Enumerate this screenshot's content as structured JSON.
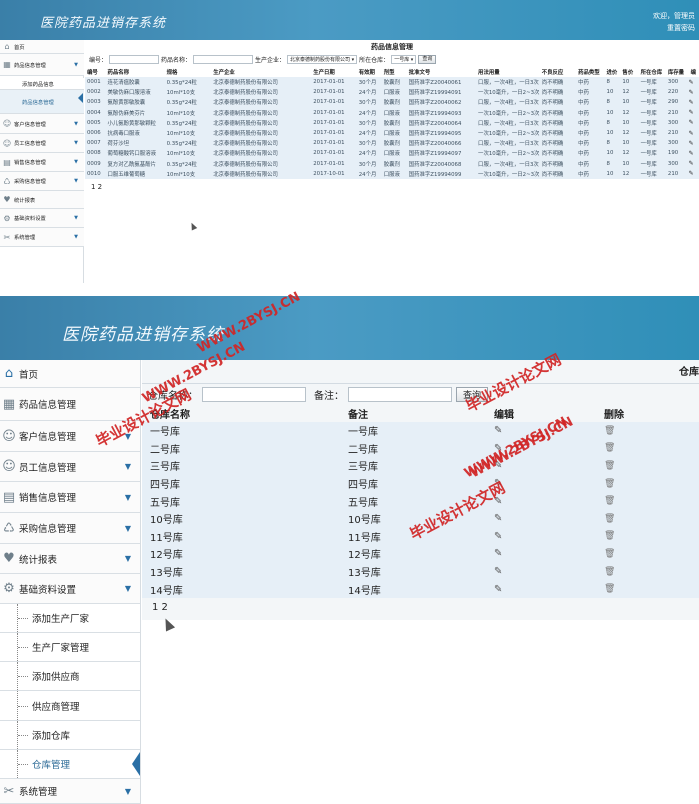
{
  "s1": {
    "logo": "医院药品进销存系统",
    "welcome": "欢迎，",
    "user": "管理员",
    "user2": "重置密码",
    "nav": [
      {
        "label": "首页",
        "icon": "home-icon",
        "arrow": ""
      },
      {
        "label": "药品信息管理",
        "icon": "grid-icon",
        "arrow": "▼"
      },
      {
        "label": "添加药品信息",
        "icon": "",
        "arrow": ""
      },
      {
        "label": "药品信息管理",
        "icon": "",
        "arrow": ""
      },
      {
        "label": "客户信息管理",
        "icon": "user-icon",
        "arrow": "▼"
      },
      {
        "label": "员工信息管理",
        "icon": "user-icon",
        "arrow": "▼"
      },
      {
        "label": "销售信息管理",
        "icon": "chart-icon",
        "arrow": "▼"
      },
      {
        "label": "采购信息管理",
        "icon": "cart-icon",
        "arrow": "▼"
      },
      {
        "label": "统计报表",
        "icon": "heart-icon",
        "arrow": ""
      },
      {
        "label": "基础资料设置",
        "icon": "settings-icon",
        "arrow": "▼"
      },
      {
        "label": "系统管理",
        "icon": "tools-icon",
        "arrow": "▼"
      }
    ],
    "title": "药品信息管理",
    "filters": {
      "code": "编号：",
      "name": "药品名称：",
      "maker": "生产企业：",
      "maker_value": "北京泰德制药股份有限公司",
      "store": "所在仓库：",
      "store_value": "一号库",
      "query": "查询"
    },
    "cols": [
      "编号",
      "药品名称",
      "规格",
      "生产企业",
      "生产日期",
      "有效期",
      "剂型",
      "批准文号",
      "用法用量",
      "不良反应",
      "药品类型",
      "进价",
      "售价",
      "所在仓库",
      "库存量",
      "编"
    ],
    "rows": [
      [
        "0001",
        "连花清瘟胶囊",
        "0.35g*24粒",
        "北京泰德制药股份有限公司",
        "2017-01-01",
        "30个月",
        "胶囊剂",
        "国药准字Z20040061",
        "口服，一次4粒，一日3次",
        "尚不明确",
        "中药",
        "8",
        "10",
        "一号库",
        "300"
      ],
      [
        "0002",
        "美敏伪麻口服溶液",
        "10ml*10支",
        "北京泰德制药股份有限公司",
        "2017-01-01",
        "24个月",
        "口服液",
        "国药准字Z19994091",
        "一次10毫升，一日2~3次",
        "尚不明确",
        "中药",
        "10",
        "12",
        "一号库",
        "220"
      ],
      [
        "0003",
        "氨酚黄那敏胶囊",
        "0.35g*24粒",
        "北京泰德制药股份有限公司",
        "2017-01-01",
        "30个月",
        "胶囊剂",
        "国药准字Z20040062",
        "口服，一次4粒，一日3次",
        "尚不明确",
        "中药",
        "8",
        "10",
        "一号库",
        "290"
      ],
      [
        "0004",
        "氨酚伪麻美芬片",
        "10ml*10支",
        "北京泰德制药股份有限公司",
        "2017-01-01",
        "24个月",
        "口服液",
        "国药准字Z19994093",
        "一次10毫升，一日2~3次",
        "尚不明确",
        "中药",
        "10",
        "12",
        "一号库",
        "210"
      ],
      [
        "0005",
        "小儿氨酚黄那敏颗粒",
        "0.35g*24粒",
        "北京泰德制药股份有限公司",
        "2017-01-01",
        "30个月",
        "胶囊剂",
        "国药准字Z20040064",
        "口服，一次4粒，一日3次",
        "尚不明确",
        "中药",
        "8",
        "10",
        "一号库",
        "300"
      ],
      [
        "0006",
        "抗病毒口服液",
        "10ml*10支",
        "北京泰德制药股份有限公司",
        "2017-01-01",
        "24个月",
        "口服液",
        "国药准字Z19994095",
        "一次10毫升，一日2~3次",
        "尚不明确",
        "中药",
        "10",
        "12",
        "一号库",
        "210"
      ],
      [
        "0007",
        "荷芬沙坦",
        "0.35g*24粒",
        "北京泰德制药股份有限公司",
        "2017-01-01",
        "30个月",
        "胶囊剂",
        "国药准字Z20040066",
        "口服，一次4粒，一日3次",
        "尚不明确",
        "中药",
        "8",
        "10",
        "一号库",
        "300"
      ],
      [
        "0008",
        "葡萄糖酸钙口服溶液",
        "10ml*10支",
        "北京泰德制药股份有限公司",
        "2017-01-01",
        "24个月",
        "口服液",
        "国药准字Z19994097",
        "一次10毫升，一日2~3次",
        "尚不明确",
        "中药",
        "10",
        "12",
        "一号库",
        "190"
      ],
      [
        "0009",
        "复方对乙酰氨基酚片",
        "0.35g*24粒",
        "北京泰德制药股份有限公司",
        "2017-01-01",
        "30个月",
        "胶囊剂",
        "国药准字Z20040068",
        "口服，一次4粒，一日3次",
        "尚不明确",
        "中药",
        "8",
        "10",
        "一号库",
        "300"
      ],
      [
        "0010",
        "口服五维葡萄糖",
        "10ml*10支",
        "北京泰德制药股份有限公司",
        "2017-10-01",
        "24个月",
        "口服液",
        "国药准字Z19994099",
        "一次10毫升，一日2~3次",
        "尚不明确",
        "中药",
        "10",
        "12",
        "一号库",
        "210"
      ]
    ],
    "pages": "1 2"
  },
  "s2": {
    "logo": "医院药品进销存系统",
    "nav": [
      {
        "label": "首页",
        "icon": "home-icon",
        "arrow": ""
      },
      {
        "label": "药品信息管理",
        "icon": "grid-icon",
        "arrow": ""
      },
      {
        "label": "客户信息管理",
        "icon": "user-icon",
        "arrow": "▼"
      },
      {
        "label": "员工信息管理",
        "icon": "user-icon",
        "arrow": "▼"
      },
      {
        "label": "销售信息管理",
        "icon": "chart-icon",
        "arrow": "▼"
      },
      {
        "label": "采购信息管理",
        "icon": "cart-icon",
        "arrow": "▼"
      },
      {
        "label": "统计报表",
        "icon": "heart-icon",
        "arrow": "▼"
      },
      {
        "label": "基础资料设置",
        "icon": "settings-icon",
        "arrow": "▼"
      },
      {
        "label": "添加生产厂家",
        "icon": "",
        "arrow": ""
      },
      {
        "label": "生产厂家管理",
        "icon": "",
        "arrow": ""
      },
      {
        "label": "添加供应商",
        "icon": "",
        "arrow": ""
      },
      {
        "label": "供应商管理",
        "icon": "",
        "arrow": ""
      },
      {
        "label": "添加仓库",
        "icon": "",
        "arrow": ""
      },
      {
        "label": "仓库管理",
        "icon": "",
        "arrow": ""
      },
      {
        "label": "系统管理",
        "icon": "tools-icon",
        "arrow": "▼"
      }
    ],
    "title": "仓库",
    "filters": {
      "name": "仓库名称：",
      "remark": "备注：",
      "query": "查询"
    },
    "cols": [
      "仓库名称",
      "备注",
      "编辑",
      "删除"
    ],
    "rows": [
      [
        "一号库",
        "一号库"
      ],
      [
        "二号库",
        "二号库"
      ],
      [
        "三号库",
        "三号库"
      ],
      [
        "四号库",
        "四号库"
      ],
      [
        "五号库",
        "五号库"
      ],
      [
        "10号库",
        "10号库"
      ],
      [
        "11号库",
        "11号库"
      ],
      [
        "12号库",
        "12号库"
      ],
      [
        "13号库",
        "13号库"
      ],
      [
        "14号库",
        "14号库"
      ]
    ],
    "pages": "1 2"
  },
  "watermarks": [
    "毕业设计论文网",
    "WWW.2BYSJ.CN",
    "WWW.2BYSJ.CN",
    "毕业设计论文网",
    "WWW.2BYSJ.CN",
    "毕业设计论文网",
    "WWW.2BYSJ.CN"
  ],
  "colors": {
    "banner": "#3f8ab4",
    "accent": "#2a6fa5",
    "row": "#e6eff7",
    "watermark": "#d12525"
  }
}
